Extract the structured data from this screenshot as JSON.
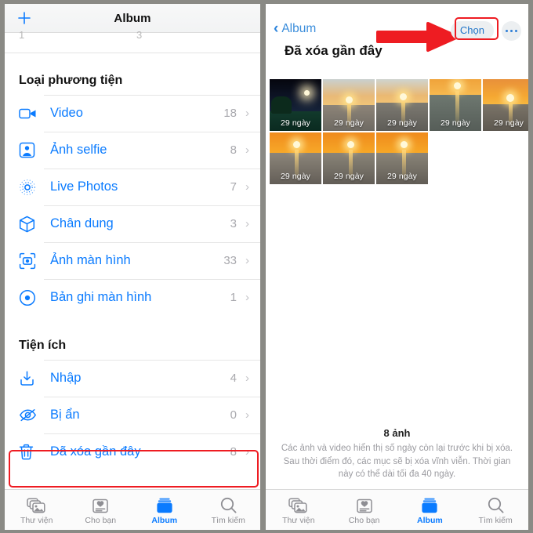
{
  "left": {
    "navbar": {
      "add_label": "+",
      "title": "Album"
    },
    "partial_row": {
      "left_value": "1",
      "right_value": "3"
    },
    "sections": [
      {
        "header": "Loại phương tiện",
        "items": [
          {
            "label": "Video",
            "count": "18",
            "icon": "video-icon"
          },
          {
            "label": "Ảnh selfie",
            "count": "8",
            "icon": "selfie-icon"
          },
          {
            "label": "Live Photos",
            "count": "7",
            "icon": "live-photos-icon"
          },
          {
            "label": "Chân dung",
            "count": "3",
            "icon": "portrait-cube-icon"
          },
          {
            "label": "Ảnh màn hình",
            "count": "33",
            "icon": "screenshot-icon"
          },
          {
            "label": "Bản ghi màn hình",
            "count": "1",
            "icon": "screen-record-icon"
          }
        ]
      },
      {
        "header": "Tiện ích",
        "items": [
          {
            "label": "Nhập",
            "count": "4",
            "icon": "import-icon"
          },
          {
            "label": "Bị ẩn",
            "count": "0",
            "icon": "eye-slash-icon"
          },
          {
            "label": "Đã xóa gần đây",
            "count": "8",
            "icon": "trash-icon",
            "highlighted": true
          }
        ]
      }
    ],
    "chevron": "›",
    "tabs": [
      {
        "label": "Thư viện",
        "icon": "library-icon",
        "active": false
      },
      {
        "label": "Cho bạn",
        "icon": "for-you-icon",
        "active": false
      },
      {
        "label": "Album",
        "icon": "albums-icon",
        "active": true
      },
      {
        "label": "Tìm kiếm",
        "icon": "search-icon",
        "active": false
      }
    ]
  },
  "right": {
    "back_label": "Album",
    "back_chevron": "‹",
    "title": "Đã xóa gần đây",
    "choose_label": "Chọn",
    "more_label": "•••",
    "photos": [
      {
        "days_label": "29 ngày",
        "style": "night"
      },
      {
        "days_label": "29 ngày",
        "style": "sunset-pale"
      },
      {
        "days_label": "29 ngày",
        "style": "sunset-pale"
      },
      {
        "days_label": "29 ngày",
        "style": "sunset-deep"
      },
      {
        "days_label": "29 ngày",
        "style": "sunset-deep"
      },
      {
        "days_label": "29 ngày",
        "style": "sunset-orange"
      },
      {
        "days_label": "29 ngày",
        "style": "sunset-orange"
      },
      {
        "days_label": "29 ngày",
        "style": "sunset-orange"
      }
    ],
    "caption_count": "8 ảnh",
    "caption_text": "Các ảnh và video hiển thị số ngày còn lại trước khi bị xóa. Sau thời điểm đó, các mục sẽ bị xóa vĩnh viễn. Thời gian này có thể dài tối đa 40 ngày.",
    "tabs": [
      {
        "label": "Thư viện",
        "icon": "library-icon",
        "active": false
      },
      {
        "label": "Cho bạn",
        "icon": "for-you-icon",
        "active": false
      },
      {
        "label": "Album",
        "icon": "albums-icon",
        "active": true
      },
      {
        "label": "Tìm kiếm",
        "icon": "search-icon",
        "active": false
      }
    ]
  },
  "annotations": {
    "accent_blue": "#0a7bff",
    "highlight_red": "#ee1c22",
    "arrow_label": "red-arrow-pointing-to-choose"
  }
}
